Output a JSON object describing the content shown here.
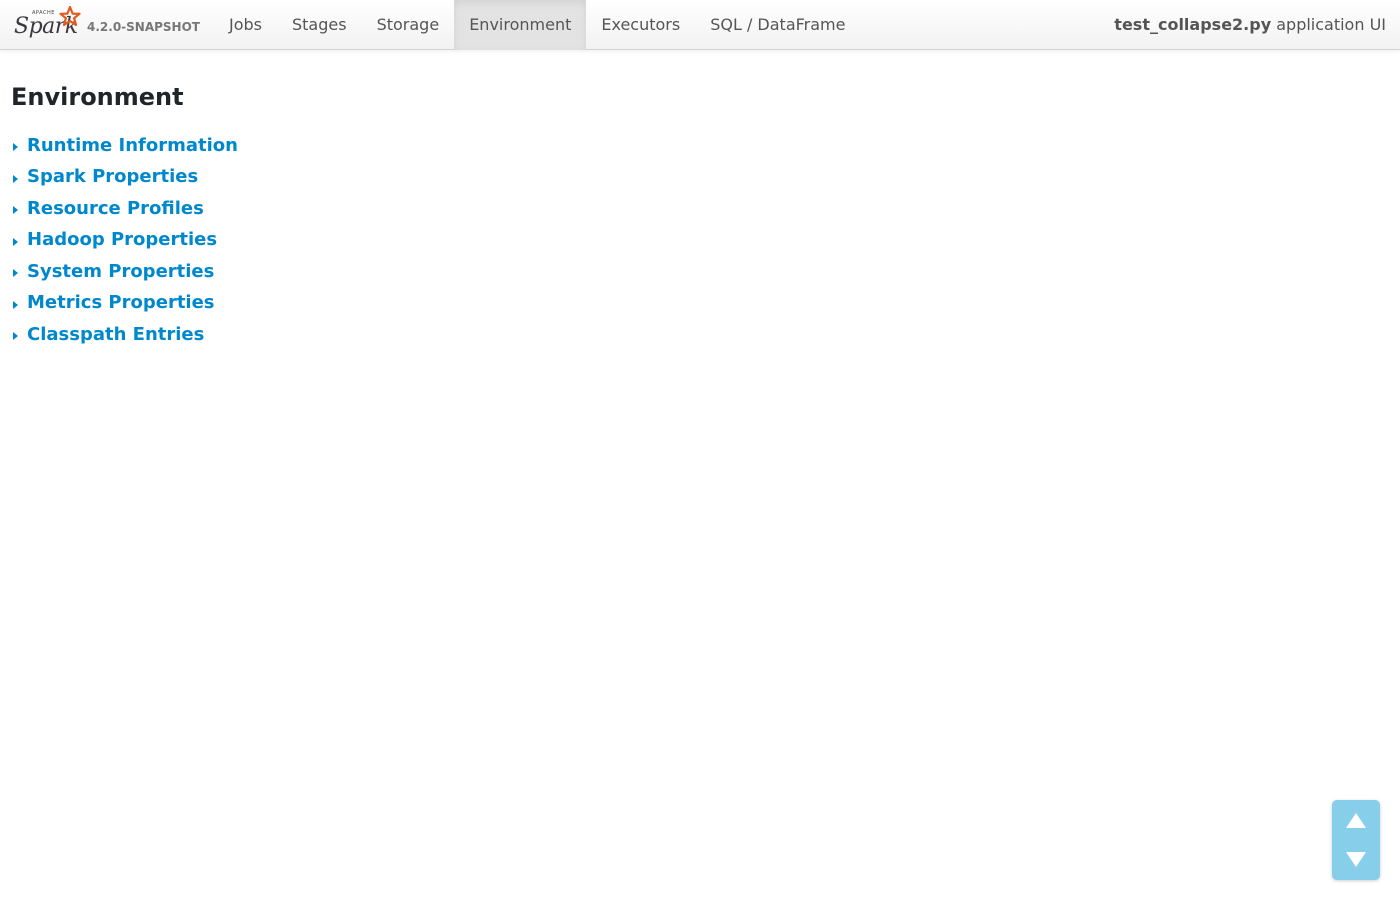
{
  "navbar": {
    "logo": {
      "apache_text": "APACHE",
      "spark_text": "Spark",
      "icon": "spark-star-icon"
    },
    "version": "4.2.0-SNAPSHOT",
    "tabs": [
      {
        "label": "Jobs",
        "active": false
      },
      {
        "label": "Stages",
        "active": false
      },
      {
        "label": "Storage",
        "active": false
      },
      {
        "label": "Environment",
        "active": true
      },
      {
        "label": "Executors",
        "active": false
      },
      {
        "label": "SQL / DataFrame",
        "active": false
      }
    ],
    "app_name": "test_collapse2.py",
    "app_suffix": " application UI"
  },
  "main": {
    "title": "Environment",
    "sections": [
      {
        "label": "Runtime Information",
        "expanded": false
      },
      {
        "label": "Spark Properties",
        "expanded": false
      },
      {
        "label": "Resource Profiles",
        "expanded": false
      },
      {
        "label": "Hadoop Properties",
        "expanded": false
      },
      {
        "label": "System Properties",
        "expanded": false
      },
      {
        "label": "Metrics Properties",
        "expanded": false
      },
      {
        "label": "Classpath Entries",
        "expanded": false
      }
    ]
  },
  "scroll_controls": {
    "up_icon": "arrow-up-icon",
    "down_icon": "arrow-down-icon"
  },
  "colors": {
    "link": "#0088cc",
    "scroll_bg": "#87ceeb",
    "active_tab_bg": "#e3e3e3",
    "star": "#e25a1c"
  }
}
